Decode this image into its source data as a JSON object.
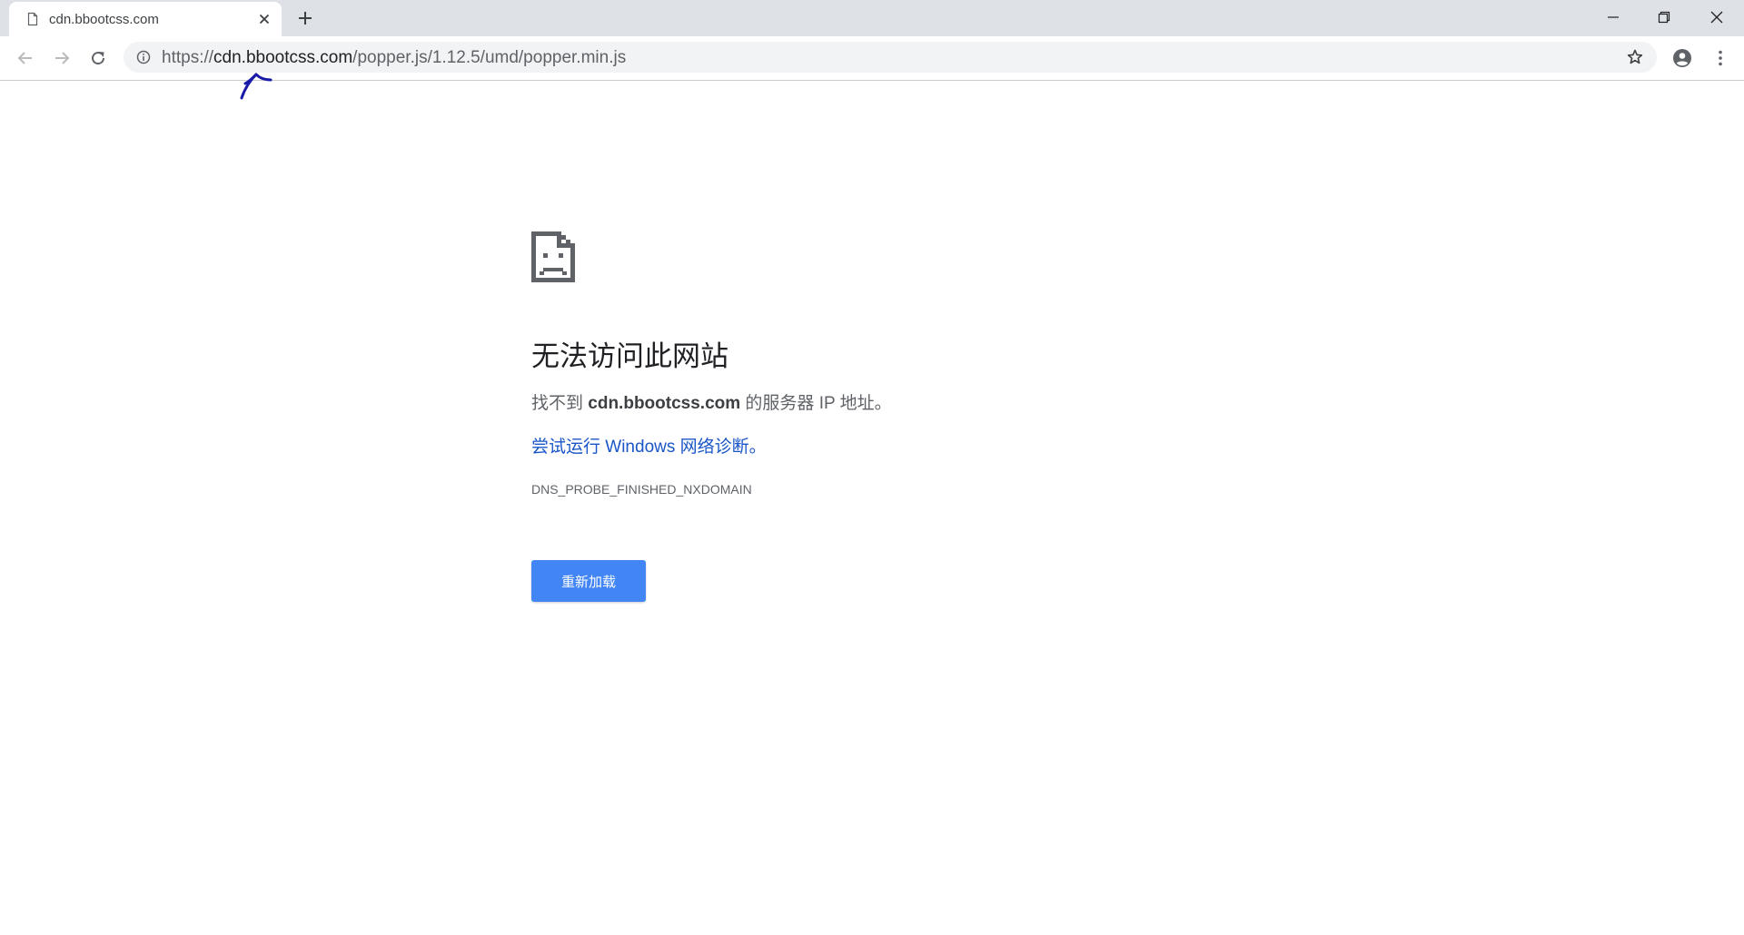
{
  "tab": {
    "favicon": "page-icon",
    "title": "cdn.bbootcss.com",
    "close_icon": "close-icon"
  },
  "window_controls": [
    "minimize-icon",
    "restore-icon",
    "close-icon"
  ],
  "toolbar": {
    "back_icon": "back-arrow-icon",
    "forward_icon": "forward-arrow-icon",
    "reload_icon": "reload-icon",
    "site_info_icon": "info-icon",
    "url_scheme": "https://",
    "url_host": "cdn.bbootcss.com",
    "url_path": "/popper.js/1.12.5/umd/popper.min.js",
    "bookmark_icon": "star-icon",
    "profile_icon": "account-icon",
    "menu_icon": "more-vert-icon"
  },
  "annotation": {
    "icon": "handwritten-arrow-icon",
    "color": "#1a1aa8"
  },
  "error": {
    "icon": "sad-page-icon",
    "heading": "无法访问此网站",
    "desc_prefix": "找不到 ",
    "desc_host": "cdn.bbootcss.com",
    "desc_suffix": " 的服务器 IP 地址。",
    "suggestion": "尝试运行 Windows 网络诊断。",
    "code": "DNS_PROBE_FINISHED_NXDOMAIN",
    "reload_label": "重新加载"
  },
  "colors": {
    "tabstrip_bg": "#dee1e6",
    "omnibox_bg": "#f1f3f4",
    "link": "#1a56c8",
    "button_bg": "#4285f4"
  }
}
